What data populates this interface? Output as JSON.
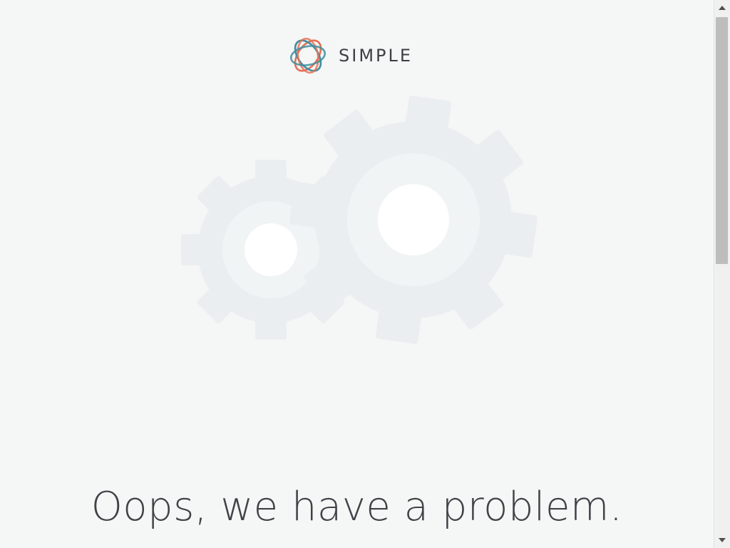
{
  "brand": {
    "name": "SIMPLE",
    "logo_icon": "simple-logo-icon",
    "colors": {
      "teal": "#3f8e9f",
      "coral": "#e57156"
    }
  },
  "illustration": {
    "icon": "gears-icon",
    "gear_color": "#ebeef1",
    "gear_inner_ring": "#f1f4f5",
    "gear_hole": "#ffffff"
  },
  "message": {
    "headline": "Oops, we have a problem."
  },
  "scrollbar": {
    "up_icon": "scroll-up-arrow-icon",
    "down_icon": "scroll-down-arrow-icon"
  }
}
